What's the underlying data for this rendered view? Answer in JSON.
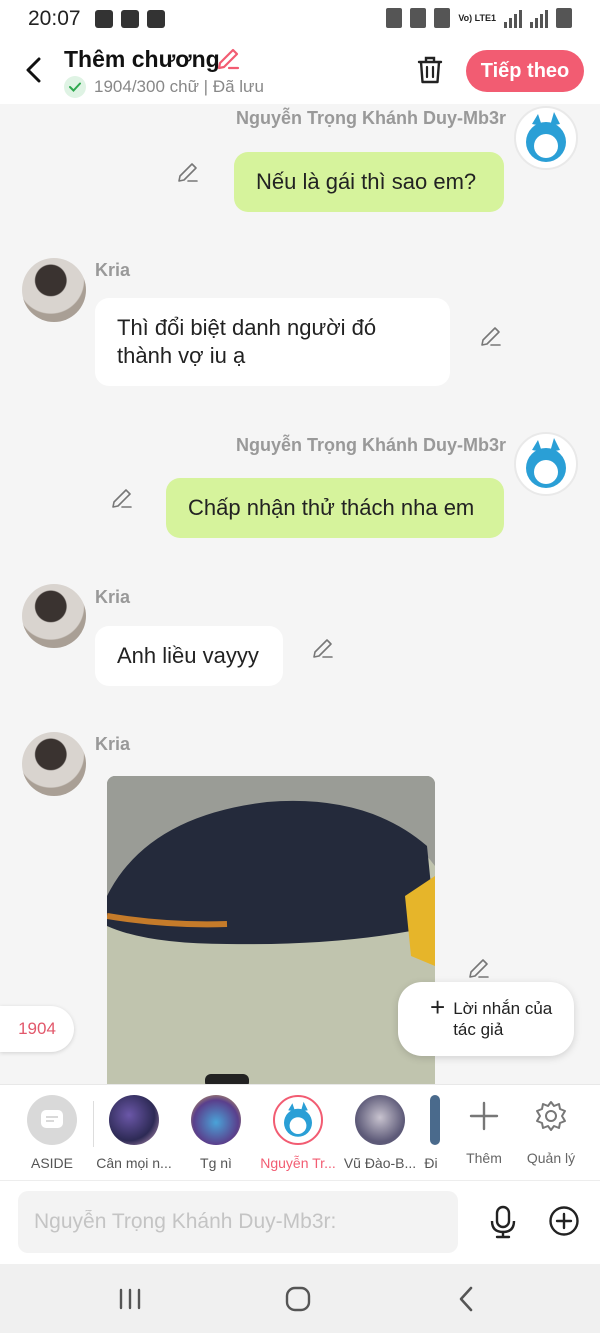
{
  "status_bar": {
    "time": "20:07",
    "lte": "Vo) LTE1"
  },
  "header": {
    "title": "Thêm chương",
    "word_status": "1904/300 chữ | Đã lưu",
    "next_label": "Tiếp theo"
  },
  "messages": [
    {
      "sender": "Nguyễn Trọng Khánh Duy-Mb3r",
      "text": "Nếu là gái thì sao em?",
      "side": "right"
    },
    {
      "sender": "Kria",
      "text": "Thì đổi biệt danh người đó thành vợ iu ạ",
      "side": "left"
    },
    {
      "sender": "Nguyễn Trọng Khánh Duy-Mb3r",
      "text": "Chấp nhận thử thách nha em",
      "side": "right"
    },
    {
      "sender": "Kria",
      "text": "Anh liều vayyy",
      "side": "left"
    },
    {
      "sender": "Kria",
      "type": "image",
      "side": "left"
    }
  ],
  "word_count_badge": "1904",
  "author_note_label": "Lời nhắn của tác giả",
  "characters": [
    {
      "name": "ASIDE"
    },
    {
      "name": "Cân mọi n..."
    },
    {
      "name": "Tg nì"
    },
    {
      "name": "Nguyễn Tr...",
      "active": true
    },
    {
      "name": "Vũ Đào-B..."
    },
    {
      "name": "Đi"
    }
  ],
  "utilities": {
    "add_label": "Thêm",
    "manage_label": "Quản lý"
  },
  "input": {
    "placeholder": "Nguyễn Trọng Khánh Duy-Mb3r:"
  },
  "colors": {
    "accent": "#f25c72",
    "my_bubble": "#d6f39c",
    "their_bubble": "#ffffff",
    "background": "#f5f5f5"
  },
  "icons": [
    "back-icon",
    "edit-icon",
    "check-icon",
    "trash-icon",
    "pencil-icon",
    "plus-icon",
    "gear-icon",
    "microphone-icon",
    "add-circle-icon",
    "recent-apps-icon",
    "home-icon",
    "nav-back-icon"
  ]
}
